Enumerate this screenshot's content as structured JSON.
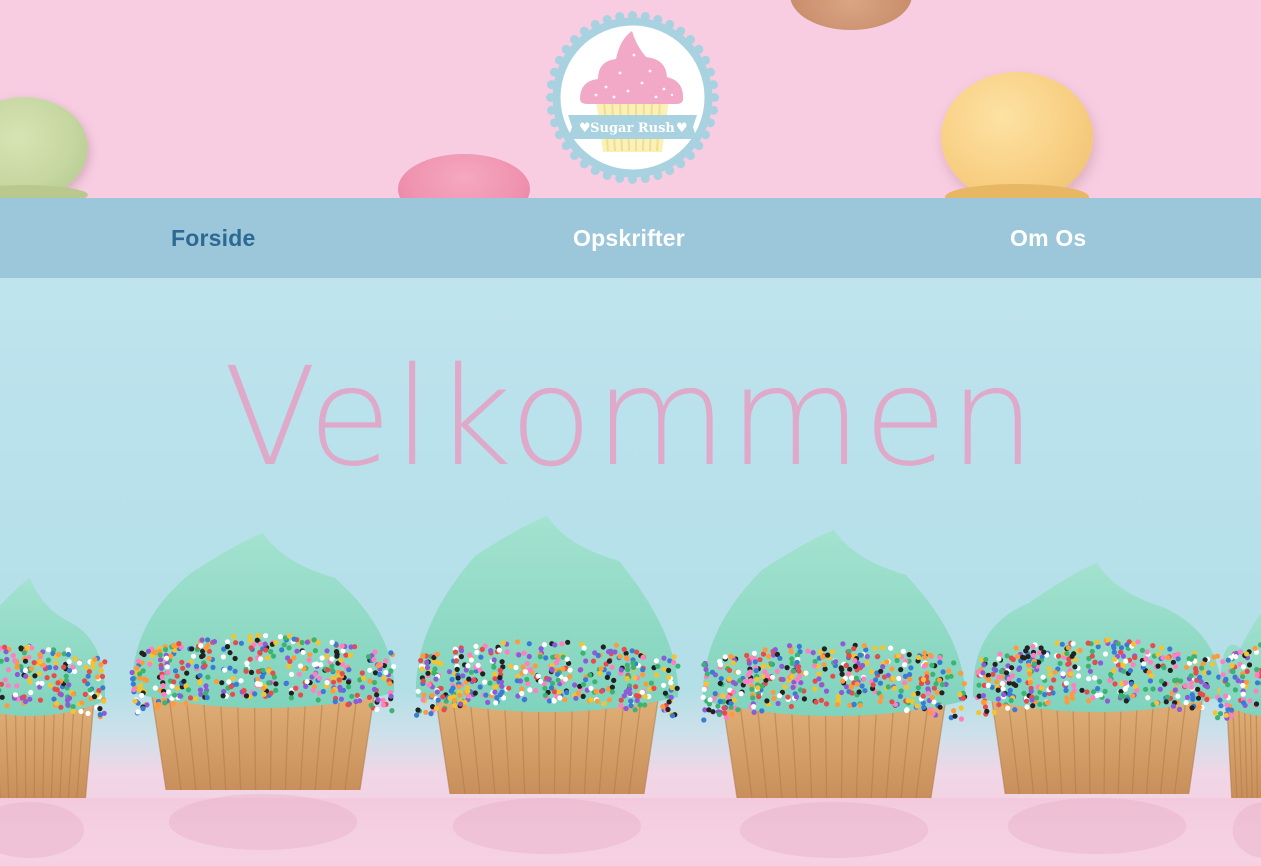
{
  "header": {
    "logo": {
      "brand_name": "Sugar Rush",
      "icon": "cupcake-icon",
      "colors": {
        "ring": "#a9d2e1",
        "frosting": "#f2a9c7",
        "liner": "#fbf0b8",
        "banner": "#a9d2e1"
      }
    }
  },
  "nav": {
    "items": [
      {
        "label": "Forside",
        "active": true
      },
      {
        "label": "Opskrifter",
        "active": false
      },
      {
        "label": "Om Os",
        "active": false
      }
    ],
    "colors": {
      "background": "#9cc7da",
      "active_text": "#2c6a93",
      "text": "#ffffff"
    }
  },
  "hero": {
    "title": "Velkommen",
    "title_color": "#e3a5c7",
    "image": "cupcakes-with-mint-frosting-and-sprinkles"
  }
}
